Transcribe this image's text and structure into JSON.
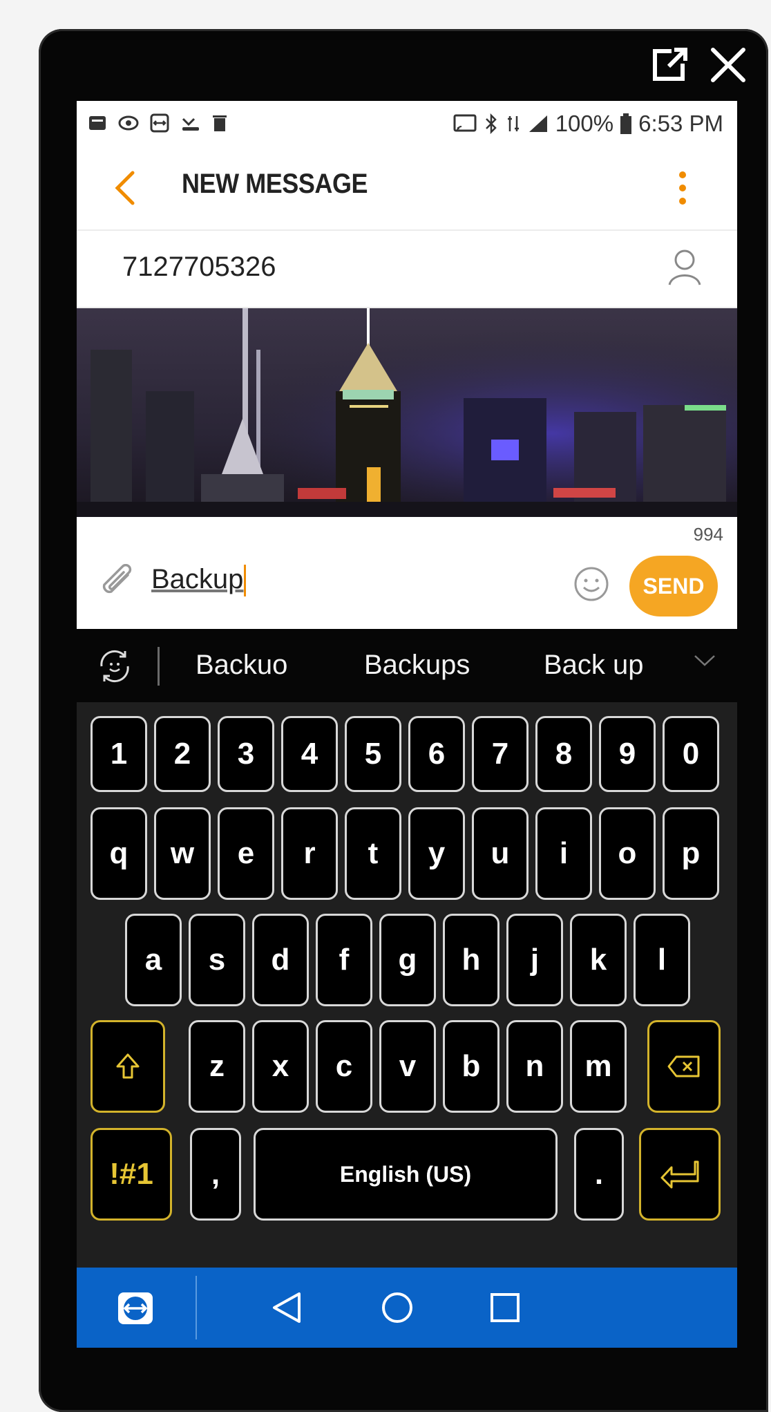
{
  "window": {
    "popout_icon": "popout-icon",
    "close_icon": "close-icon"
  },
  "status_bar": {
    "battery": "100%",
    "time": "6:53 PM"
  },
  "app_bar": {
    "title": "NEW MESSAGE",
    "back_icon": "chevron-left-icon",
    "more_icon": "more-vertical-icon",
    "accent_color": "#f08c00"
  },
  "recipient": {
    "number": "7127705326",
    "icon": "contact-icon"
  },
  "compose": {
    "char_counter": "994",
    "text": "Backup",
    "send_label": "SEND",
    "send_color": "#f5a623"
  },
  "suggestions": {
    "items": [
      "Backuo",
      "Backups",
      "Back up"
    ]
  },
  "keyboard": {
    "number_row": [
      "1",
      "2",
      "3",
      "4",
      "5",
      "6",
      "7",
      "8",
      "9",
      "0"
    ],
    "row1": [
      "q",
      "w",
      "e",
      "r",
      "t",
      "y",
      "u",
      "i",
      "o",
      "p"
    ],
    "row2": [
      "a",
      "s",
      "d",
      "f",
      "g",
      "h",
      "j",
      "k",
      "l"
    ],
    "row3": [
      "z",
      "x",
      "c",
      "v",
      "b",
      "n",
      "m"
    ],
    "symbols_label": "!#1",
    "comma": ",",
    "space_label": "English (US)",
    "period": ".",
    "func_color": "#d3b32b"
  },
  "nav_bar": {
    "color": "#0a63c7",
    "items": [
      "teamviewer-icon",
      "back-icon",
      "home-icon",
      "recents-icon"
    ]
  }
}
